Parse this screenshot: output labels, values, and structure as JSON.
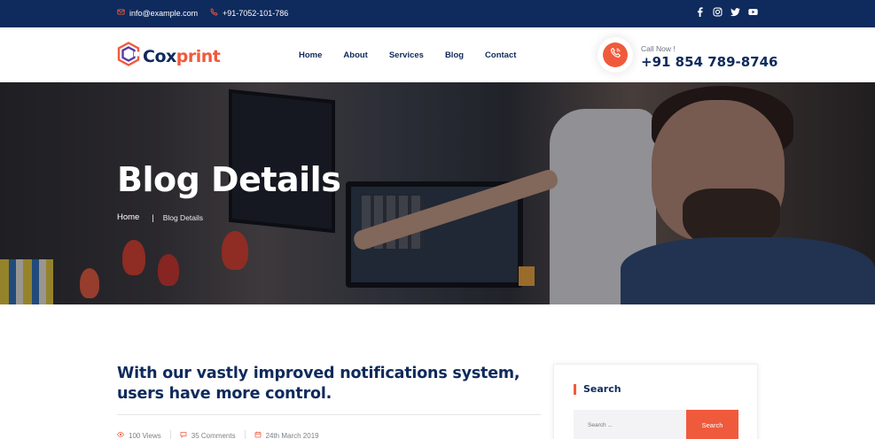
{
  "topbar": {
    "email": "info@example.com",
    "phone": "+91-7052-101-786",
    "socials": [
      "facebook-icon",
      "instagram-icon",
      "twitter-icon",
      "youtube-icon"
    ],
    "bg_color": "#0f2a5c"
  },
  "header": {
    "brand_part1": "Cox",
    "brand_part2": "print",
    "nav": [
      "Home",
      "About",
      "Services",
      "Blog",
      "Contact"
    ],
    "call_label": "Call Now !",
    "call_number": "+91 854 789-8746",
    "accent_color": "#f05a3c",
    "primary_color": "#0f2a5c"
  },
  "hero": {
    "title": "Blog Details",
    "breadcrumb": {
      "home": "Home",
      "separator": "|",
      "current": "Blog Details"
    }
  },
  "post": {
    "title": "With our vastly improved notifications system, users have more control.",
    "views": "100 Views",
    "comments": "35 Comments",
    "date": "24th March 2019"
  },
  "sidebar": {
    "search_title": "Search",
    "search_placeholder": "Search ...",
    "search_button": "Search"
  }
}
